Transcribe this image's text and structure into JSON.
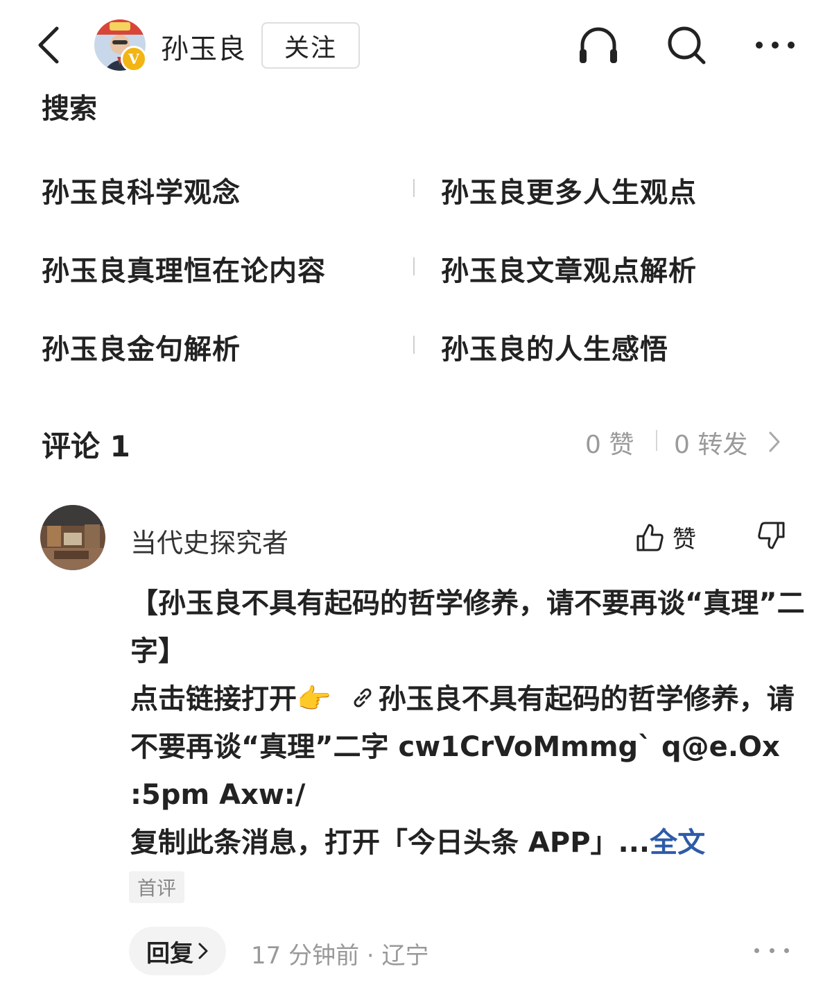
{
  "header": {
    "author_name": "孙玉良",
    "follow_label": "关注",
    "verified_badge": "V",
    "colors": {
      "badge": "#f3b514"
    }
  },
  "search": {
    "title": "搜索",
    "items": [
      {
        "label": "孙玉良科学观念"
      },
      {
        "label": "孙玉良更多人生观点"
      },
      {
        "label": "孙玉良真理恒在论内容"
      },
      {
        "label": "孙玉良文章观点解析"
      },
      {
        "label": "孙玉良金句解析"
      },
      {
        "label": "孙玉良的人生感悟"
      }
    ]
  },
  "comments_header": {
    "title": "评论 1",
    "likes": "0 赞",
    "reposts": "0 转发"
  },
  "comment": {
    "username": "当代史探究者",
    "like_label": "赞",
    "body_line1": "【孙玉良不具有起码的哲学修养，请不要再谈“真理”二字】",
    "body_line2_prefix": "点击链接打开",
    "emoji": "👉",
    "body_line2_rest": "孙玉良不具有起码的哲学修养，请不要再谈“真理”二字 cw1CrVoMmmg` q@e.Ox :5pm Axw:/",
    "body_line3": "复制此条消息，打开「今日头条 APP」...",
    "full_text_link": "全文",
    "tag": "首评",
    "reply_label": "回复",
    "meta": "17 分钟前 · 辽宁"
  },
  "icons": [
    "back-icon",
    "headphones-icon",
    "search-icon",
    "more-icon",
    "thumbs-up-icon",
    "thumbs-down-icon",
    "link-icon",
    "chevron-right-icon",
    "verified-icon"
  ]
}
